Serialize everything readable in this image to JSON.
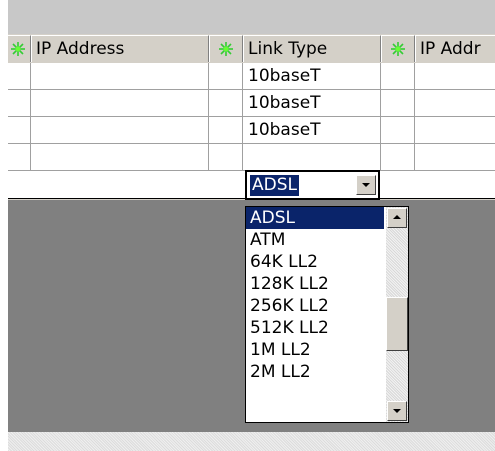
{
  "grid": {
    "columns": [
      {
        "kind": "icon",
        "icon": "green-star-icon"
      },
      {
        "kind": "text",
        "label": "IP Address"
      },
      {
        "kind": "icon",
        "icon": "green-star-icon"
      },
      {
        "kind": "text",
        "label": "Link Type"
      },
      {
        "kind": "icon",
        "icon": "green-star-icon"
      },
      {
        "kind": "text",
        "label": "IP Addr"
      }
    ],
    "rows": [
      {
        "ip_address": "",
        "link_type": "10baseT",
        "ip_addr2": ""
      },
      {
        "ip_address": "",
        "link_type": "10baseT",
        "ip_addr2": ""
      },
      {
        "ip_address": "",
        "link_type": "10baseT",
        "ip_addr2": ""
      }
    ]
  },
  "combo": {
    "value": "ADSL"
  },
  "dropdown": {
    "options": [
      "ADSL",
      "ATM",
      "64K LL2",
      "128K LL2",
      "256K LL2",
      "512K LL2",
      "1M LL2",
      "2M LL2"
    ],
    "selected_index": 0,
    "scroll_position": 0.58
  },
  "colors": {
    "selection": "#0a246a",
    "face": "#d4d0c8",
    "empty_area": "#808080",
    "icon_green": "#33cc33"
  }
}
